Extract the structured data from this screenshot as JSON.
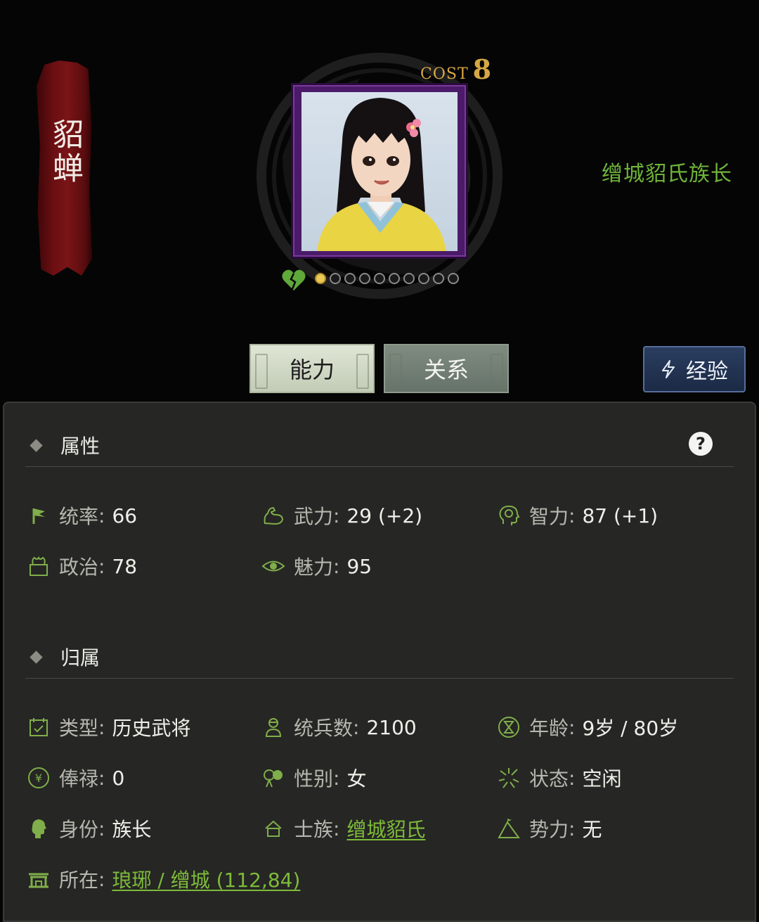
{
  "character": {
    "name": "貂蝉",
    "title": "缯城貂氏族长",
    "cost_label": "COST",
    "cost_value": "8",
    "page_dots": 10,
    "active_dot": 0
  },
  "tabs": [
    {
      "label": "能力",
      "active": true
    },
    {
      "label": "关系",
      "active": false
    }
  ],
  "exp_button": {
    "label": "经验"
  },
  "sections": {
    "attributes": {
      "title": "属性",
      "help": "?"
    },
    "affiliation": {
      "title": "归属"
    }
  },
  "stats": {
    "command": {
      "label": "统率",
      "value": "66"
    },
    "strength": {
      "label": "武力",
      "value": "29 (+2)"
    },
    "intelligence": {
      "label": "智力",
      "value": "87 (+1)"
    },
    "politics": {
      "label": "政治",
      "value": "78"
    },
    "charm": {
      "label": "魅力",
      "value": "95"
    }
  },
  "info": {
    "type": {
      "label": "类型",
      "value": "历史武将"
    },
    "troops": {
      "label": "统兵数",
      "value": "2100"
    },
    "age": {
      "label": "年龄",
      "value": "9岁 / 80岁"
    },
    "salary": {
      "label": "俸禄",
      "value": "0"
    },
    "gender": {
      "label": "性别",
      "value": "女"
    },
    "status": {
      "label": "状态",
      "value": "空闲"
    },
    "identity": {
      "label": "身份",
      "value": "族长"
    },
    "clan": {
      "label": "士族",
      "value": "缯城貂氏"
    },
    "faction": {
      "label": "势力",
      "value": "无"
    },
    "location": {
      "label": "所在",
      "value": "琅琊 / 缯城 (112,84)"
    }
  },
  "colors": {
    "link": "#7dbb3a",
    "title_green": "#6fb43a",
    "banner_red": "#7a1417",
    "cost_gold": "#d6a843",
    "portrait_frame": "#4b1b6a"
  }
}
